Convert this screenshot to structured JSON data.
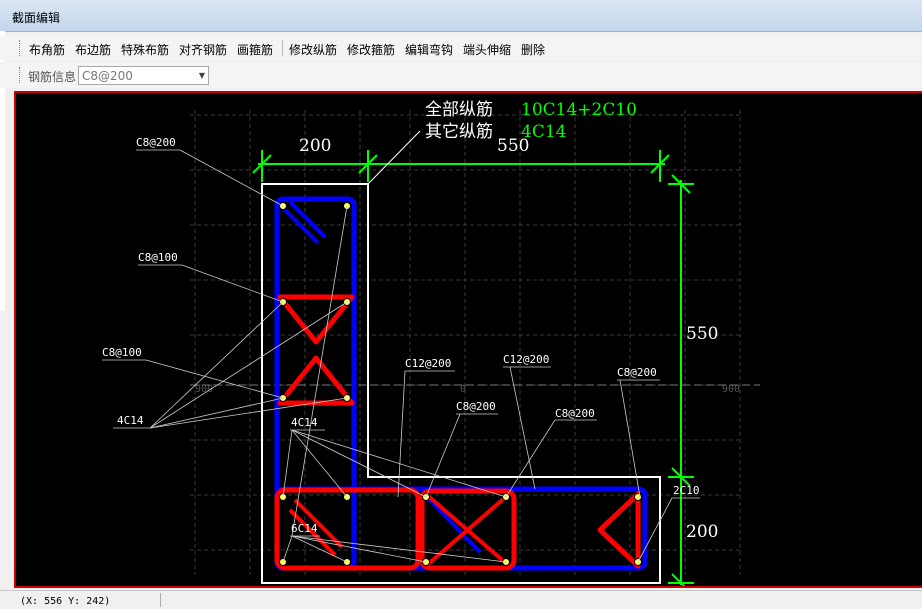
{
  "window": {
    "title": "截面编辑"
  },
  "toolbar": {
    "buttons": [
      "布角筋",
      "布边筋",
      "特殊布筋",
      "对齐钢筋",
      "画箍筋",
      "修改纵筋",
      "修改箍筋",
      "编辑弯钩",
      "端头伸缩",
      "删除"
    ]
  },
  "rebar_info": {
    "label": "钢筋信息",
    "value": "C8@200"
  },
  "canvas": {
    "summary": {
      "all_label": "全部纵筋",
      "all_value": "10C14+2C10",
      "other_label": "其它纵筋",
      "other_value": "4C14"
    },
    "dimensions": {
      "top_left": "200",
      "top_right": "550",
      "right_upper": "550",
      "right_lower": "200"
    },
    "axis_labels": {
      "left": "900",
      "center": "0",
      "right": "900"
    },
    "annotations": [
      "C8@200",
      "C8@100",
      "C8@100",
      "4C14",
      "4C14",
      "6C14",
      "C12@200",
      "C12@200",
      "C8@200",
      "C8@200",
      "C8@200",
      "2C10"
    ]
  },
  "status": {
    "coords": "(X: 556 Y: 242)"
  },
  "colors": {
    "canvas_bg": "#000000",
    "stirrup_outer": "#0000ff",
    "stirrup_tie": "#ff0000",
    "dimension": "#00ff00",
    "outline": "#ffffff"
  }
}
